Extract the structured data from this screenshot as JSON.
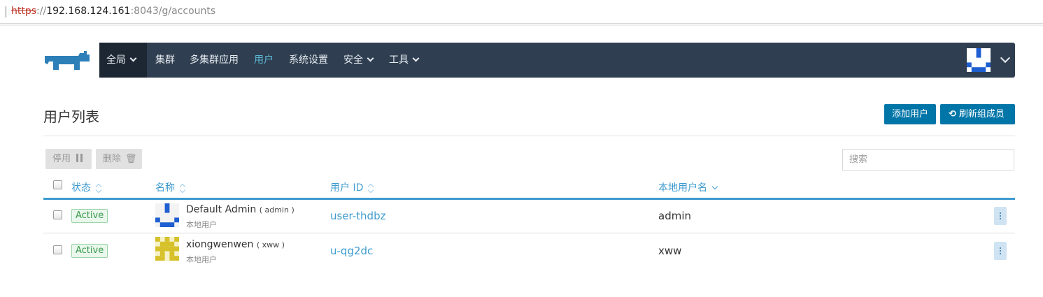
{
  "browser": {
    "url_scheme": "https",
    "url_sep": "://",
    "url_host": "192.168.124.161",
    "url_rest": ":8043/g/accounts"
  },
  "nav": {
    "global": "全局",
    "items": [
      "集群",
      "多集群应用",
      "用户",
      "系统设置",
      "安全",
      "工具"
    ],
    "active": "用户",
    "accent": "#5bbad5",
    "bg": "#2f3e50"
  },
  "page": {
    "title": "用户列表",
    "add_user": "添加用户",
    "refresh_groups": "刷新组成员",
    "bulk_deactivate": "停用",
    "bulk_delete": "删除",
    "search_placeholder": "搜索"
  },
  "table": {
    "columns": [
      "状态",
      "名称",
      "用户 ID",
      "本地用户名"
    ],
    "rows": [
      {
        "status": "Active",
        "name": "Default Admin",
        "login": "( admin )",
        "type": "本地用户",
        "id": "user-thdbz",
        "username": "admin",
        "avatar_color": "#1f5fd1"
      },
      {
        "status": "Active",
        "name": "xiongwenwen",
        "login": "( xww )",
        "type": "本地用户",
        "id": "u-qg2dc",
        "username": "xww",
        "avatar_color": "#d6c12a"
      }
    ]
  },
  "colors": {
    "primary": "#0075a8",
    "link": "#3e9bd0",
    "status_active": "#3a9a4e"
  }
}
